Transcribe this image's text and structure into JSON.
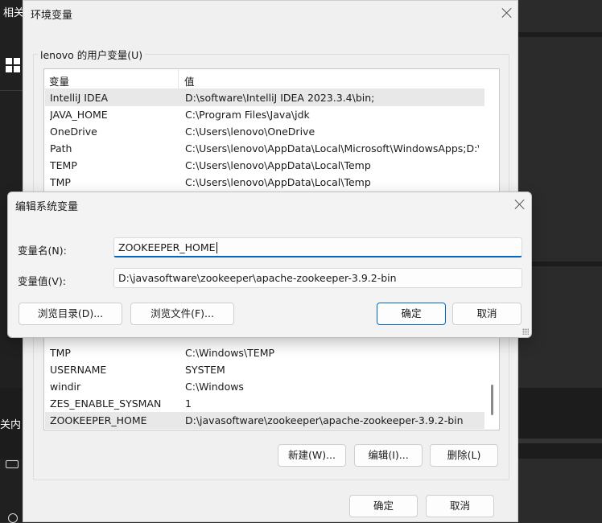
{
  "background": {
    "top_left_text": "相关",
    "side_text": "关内"
  },
  "env_window": {
    "title": "环境变量",
    "user_group_label": "lenovo 的用户变量(U)",
    "columns": [
      "变量",
      "值"
    ],
    "user_vars": [
      {
        "name": "IntelliJ IDEA",
        "value": "D:\\software\\IntelliJ IDEA 2023.3.4\\bin;"
      },
      {
        "name": "JAVA_HOME",
        "value": "C:\\Program Files\\Java\\jdk"
      },
      {
        "name": "OneDrive",
        "value": "C:\\Users\\lenovo\\OneDrive"
      },
      {
        "name": "Path",
        "value": "C:\\Users\\lenovo\\AppData\\Local\\Microsoft\\WindowsApps;D:\\..."
      },
      {
        "name": "TEMP",
        "value": "C:\\Users\\lenovo\\AppData\\Local\\Temp"
      },
      {
        "name": "TMP",
        "value": "C:\\Users\\lenovo\\AppData\\Local\\Temp"
      }
    ],
    "system_vars": [
      {
        "name": "TMP",
        "value": "C:\\Windows\\TEMP"
      },
      {
        "name": "USERNAME",
        "value": "SYSTEM"
      },
      {
        "name": "windir",
        "value": "C:\\Windows"
      },
      {
        "name": "ZES_ENABLE_SYSMAN",
        "value": "1"
      },
      {
        "name": "ZOOKEEPER_HOME",
        "value": "D:\\javasoftware\\zookeeper\\apache-zookeeper-3.9.2-bin"
      }
    ],
    "system_buttons": {
      "new": "新建(W)...",
      "edit": "编辑(I)...",
      "delete": "删除(L)"
    },
    "ok": "确定",
    "cancel": "取消"
  },
  "edit_dialog": {
    "title": "编辑系统变量",
    "name_label": "变量名(N):",
    "name_value": "ZOOKEEPER_HOME",
    "value_label": "变量值(V):",
    "value_value": "D:\\javasoftware\\zookeeper\\apache-zookeeper-3.9.2-bin",
    "browse_dir": "浏览目录(D)...",
    "browse_file": "浏览文件(F)...",
    "ok": "确定",
    "cancel": "取消"
  }
}
